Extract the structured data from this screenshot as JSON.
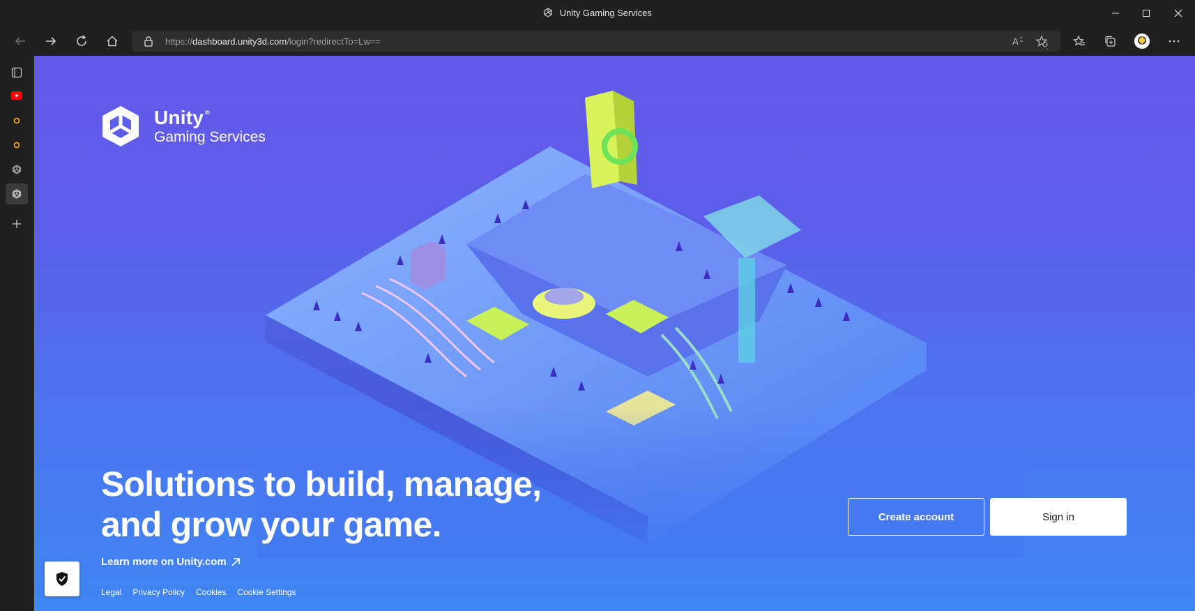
{
  "window": {
    "title": "Unity Gaming Services"
  },
  "toolbar": {
    "url_prefix": "https://",
    "url_host": "dashboard.unity3d.com",
    "url_path": "/login?redirectTo=Lw=="
  },
  "sidebar": {
    "items": [
      {
        "name": "tab-actions-icon"
      },
      {
        "name": "youtube-icon"
      },
      {
        "name": "circle-tab-icon-1"
      },
      {
        "name": "circle-tab-icon-2"
      },
      {
        "name": "unity-tab-icon-1"
      },
      {
        "name": "unity-tab-icon-2"
      },
      {
        "name": "add-tab-icon"
      }
    ]
  },
  "brand": {
    "name": "Unity",
    "trademark": "®",
    "subtitle": "Gaming Services"
  },
  "hero": {
    "headline_line1": "Solutions to build, manage,",
    "headline_line2": "and grow your game.",
    "learn_more": "Learn more on Unity.com"
  },
  "actions": {
    "create_account": "Create account",
    "sign_in": "Sign in"
  },
  "footer": {
    "legal": "Legal",
    "privacy": "Privacy Policy",
    "cookies": "Cookies",
    "cookie_settings": "Cookie Settings"
  },
  "colors": {
    "page_top": "#6458e8",
    "page_bottom": "#3f86f2",
    "chrome": "#202020",
    "address_bar": "#2e2e2e"
  }
}
